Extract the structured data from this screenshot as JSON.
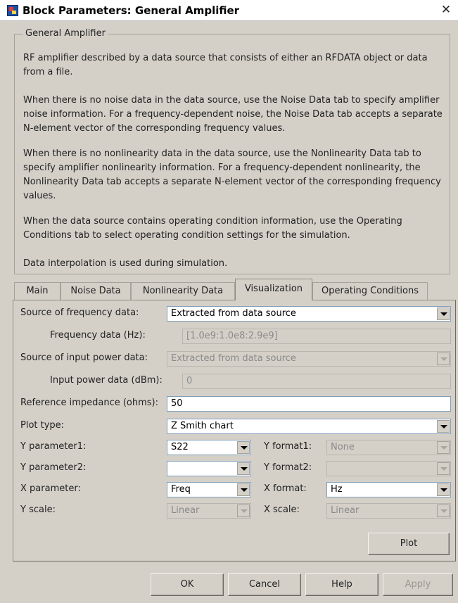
{
  "window": {
    "title": "Block Parameters: General Amplifier"
  },
  "description": {
    "group_title": "General Amplifier",
    "paragraphs": [
      "RF amplifier described by a data source that consists of either an RFDATA object or data from a file.",
      "When there is no noise data in the data source, use the Noise Data tab to specify amplifier noise information. For a frequency-dependent noise, the Noise Data tab accepts a separate N-element vector of the corresponding frequency values.",
      "When there is no nonlinearity data in the data source, use the Nonlinearity Data tab to specify amplifier nonlinearity information. For a frequency-dependent nonlinearity, the Nonlinearity Data tab accepts a separate N-element vector of the corresponding frequency values.",
      "When the data source contains operating condition information, use the Operating Conditions tab to select operating condition settings for the simulation.",
      "Data interpolation is used during simulation."
    ]
  },
  "tabs": [
    "Main",
    "Noise Data",
    "Nonlinearity Data",
    "Visualization",
    "Operating Conditions"
  ],
  "active_tab": "Visualization",
  "form": {
    "source_freq": {
      "label": "Source of frequency data:",
      "value": "Extracted from data source"
    },
    "freq_data": {
      "label": "Frequency data (Hz):",
      "value": "[1.0e9:1.0e8:2.9e9]"
    },
    "source_power": {
      "label": "Source of input power data:",
      "value": "Extracted from data source"
    },
    "input_power": {
      "label": "Input power data (dBm):",
      "value": "0"
    },
    "ref_impedance": {
      "label": "Reference impedance (ohms):",
      "value": "50"
    },
    "plot_type": {
      "label": "Plot type:",
      "value": "Z Smith chart"
    },
    "y_param1": {
      "label": "Y parameter1:",
      "value": "S22"
    },
    "y_format1": {
      "label": "Y format1:",
      "value": "None"
    },
    "y_param2": {
      "label": "Y parameter2:",
      "value": ""
    },
    "y_format2": {
      "label": "Y format2:",
      "value": ""
    },
    "x_param": {
      "label": "X parameter:",
      "value": "Freq"
    },
    "x_format": {
      "label": "X format:",
      "value": "Hz"
    },
    "y_scale": {
      "label": "Y scale:",
      "value": "Linear"
    },
    "x_scale": {
      "label": "X scale:",
      "value": "Linear"
    },
    "plot_button": "Plot"
  },
  "buttons": {
    "ok": "OK",
    "cancel": "Cancel",
    "help": "Help",
    "apply": "Apply"
  }
}
